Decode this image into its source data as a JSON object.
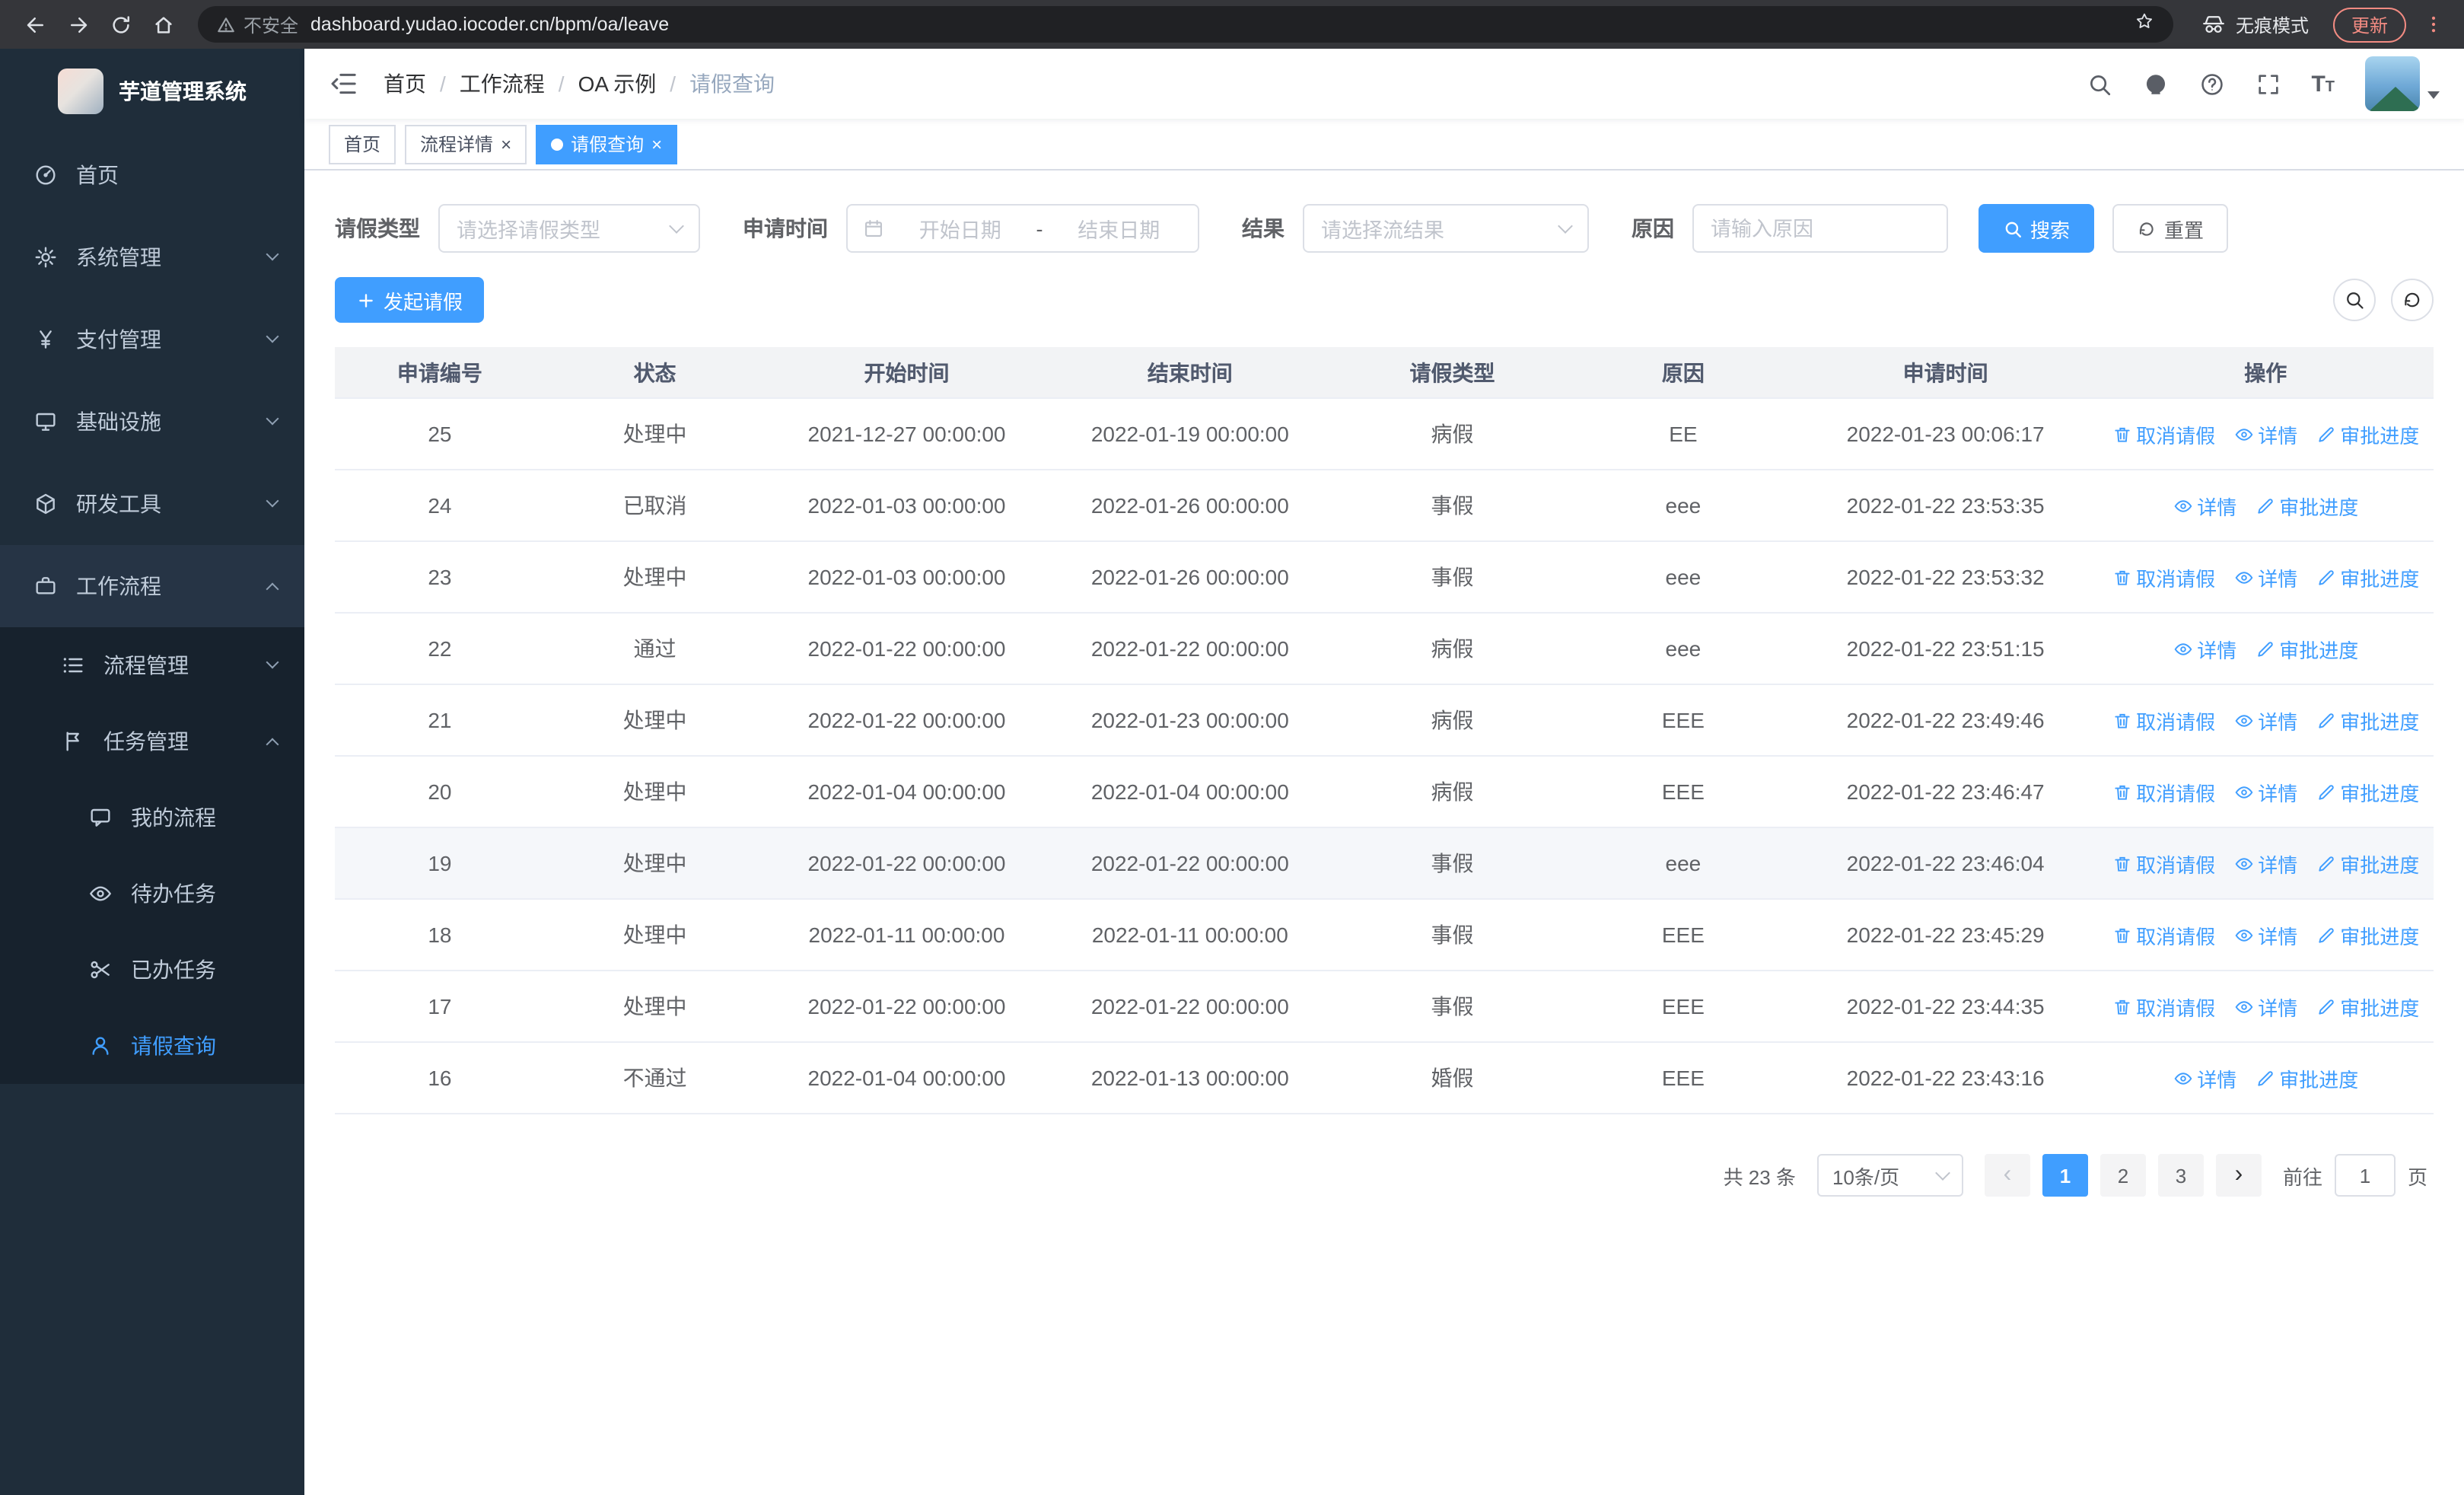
{
  "colors": {
    "accent": "#409eff",
    "sidebar_bg": "#1f2d3a",
    "update_pill": "#f28b82"
  },
  "browser": {
    "security_label": "不安全",
    "url": "dashboard.yudao.iocoder.cn/bpm/oa/leave",
    "incognito_label": "无痕模式",
    "update_label": "更新"
  },
  "sidebar": {
    "logo_title": "芋道管理系统",
    "items": [
      {
        "label": "首页"
      },
      {
        "label": "系统管理"
      },
      {
        "label": "支付管理"
      },
      {
        "label": "基础设施"
      },
      {
        "label": "研发工具"
      },
      {
        "label": "工作流程"
      },
      {
        "label": "流程管理"
      },
      {
        "label": "任务管理"
      },
      {
        "label": "我的流程"
      },
      {
        "label": "待办任务"
      },
      {
        "label": "已办任务"
      },
      {
        "label": "请假查询"
      }
    ]
  },
  "breadcrumb": [
    "首页",
    "工作流程",
    "OA 示例",
    "请假查询"
  ],
  "tabs": [
    {
      "label": "首页"
    },
    {
      "label": "流程详情"
    },
    {
      "label": "请假查询"
    }
  ],
  "filters": {
    "leave_type_label": "请假类型",
    "leave_type_placeholder": "请选择请假类型",
    "apply_time_label": "申请时间",
    "start_date_placeholder": "开始日期",
    "range_separator": "-",
    "end_date_placeholder": "结束日期",
    "result_label": "结果",
    "result_placeholder": "请选择流结果",
    "reason_label": "原因",
    "reason_placeholder": "请输入原因",
    "search_label": "搜索",
    "reset_label": "重置"
  },
  "toolbar": {
    "create_label": "发起请假"
  },
  "table": {
    "columns": [
      "申请编号",
      "状态",
      "开始时间",
      "结束时间",
      "请假类型",
      "原因",
      "申请时间",
      "操作"
    ],
    "actions": {
      "cancel": "取消请假",
      "detail": "详情",
      "progress": "审批进度"
    },
    "rows": [
      {
        "id": "25",
        "status": "处理中",
        "start": "2021-12-27 00:00:00",
        "end": "2022-01-19 00:00:00",
        "type": "病假",
        "reason": "EE",
        "apply_time": "2022-01-23 00:06:17",
        "actions": [
          "cancel",
          "detail",
          "progress"
        ]
      },
      {
        "id": "24",
        "status": "已取消",
        "start": "2022-01-03 00:00:00",
        "end": "2022-01-26 00:00:00",
        "type": "事假",
        "reason": "eee",
        "apply_time": "2022-01-22 23:53:35",
        "actions": [
          "detail",
          "progress"
        ]
      },
      {
        "id": "23",
        "status": "处理中",
        "start": "2022-01-03 00:00:00",
        "end": "2022-01-26 00:00:00",
        "type": "事假",
        "reason": "eee",
        "apply_time": "2022-01-22 23:53:32",
        "actions": [
          "cancel",
          "detail",
          "progress"
        ]
      },
      {
        "id": "22",
        "status": "通过",
        "start": "2022-01-22 00:00:00",
        "end": "2022-01-22 00:00:00",
        "type": "病假",
        "reason": "eee",
        "apply_time": "2022-01-22 23:51:15",
        "actions": [
          "detail",
          "progress"
        ]
      },
      {
        "id": "21",
        "status": "处理中",
        "start": "2022-01-22 00:00:00",
        "end": "2022-01-23 00:00:00",
        "type": "病假",
        "reason": "EEE",
        "apply_time": "2022-01-22 23:49:46",
        "actions": [
          "cancel",
          "detail",
          "progress"
        ]
      },
      {
        "id": "20",
        "status": "处理中",
        "start": "2022-01-04 00:00:00",
        "end": "2022-01-04 00:00:00",
        "type": "病假",
        "reason": "EEE",
        "apply_time": "2022-01-22 23:46:47",
        "actions": [
          "cancel",
          "detail",
          "progress"
        ]
      },
      {
        "id": "19",
        "status": "处理中",
        "start": "2022-01-22 00:00:00",
        "end": "2022-01-22 00:00:00",
        "type": "事假",
        "reason": "eee",
        "apply_time": "2022-01-22 23:46:04",
        "actions": [
          "cancel",
          "detail",
          "progress"
        ],
        "hover": true
      },
      {
        "id": "18",
        "status": "处理中",
        "start": "2022-01-11 00:00:00",
        "end": "2022-01-11 00:00:00",
        "type": "事假",
        "reason": "EEE",
        "apply_time": "2022-01-22 23:45:29",
        "actions": [
          "cancel",
          "detail",
          "progress"
        ]
      },
      {
        "id": "17",
        "status": "处理中",
        "start": "2022-01-22 00:00:00",
        "end": "2022-01-22 00:00:00",
        "type": "事假",
        "reason": "EEE",
        "apply_time": "2022-01-22 23:44:35",
        "actions": [
          "cancel",
          "detail",
          "progress"
        ]
      },
      {
        "id": "16",
        "status": "不通过",
        "start": "2022-01-04 00:00:00",
        "end": "2022-01-13 00:00:00",
        "type": "婚假",
        "reason": "EEE",
        "apply_time": "2022-01-22 23:43:16",
        "actions": [
          "detail",
          "progress"
        ]
      }
    ]
  },
  "pagination": {
    "total_label": "共 23 条",
    "page_size_label": "10条/页",
    "pages": [
      "1",
      "2",
      "3"
    ],
    "active_page": "1",
    "goto_label": "前往",
    "goto_value": "1",
    "page_unit_label": "页"
  }
}
